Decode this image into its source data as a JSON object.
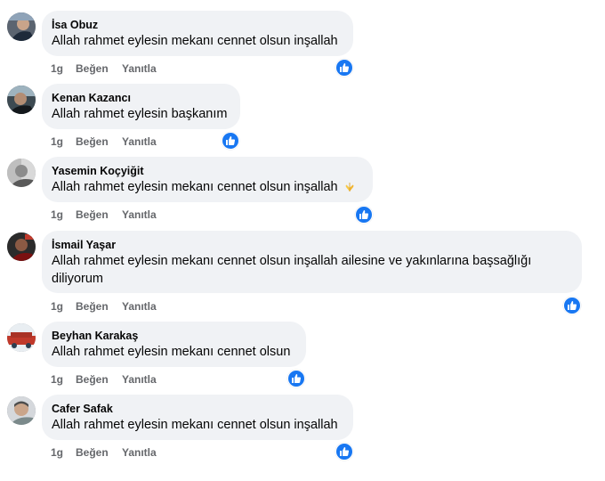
{
  "comments": [
    {
      "author": "İsa Obuz",
      "text": "Allah rahmet eylesin mekanı cennet olsun inşallah",
      "time": "1g",
      "like": "Beğen",
      "reply": "Yanıtla",
      "reaction": "like-icon"
    },
    {
      "author": "Kenan Kazancı",
      "text": "Allah rahmet eylesin başkanım",
      "time": "1g",
      "like": "Beğen",
      "reply": "Yanıtla",
      "reaction": "like-icon"
    },
    {
      "author": "Yasemin Koçyiğit",
      "text": "Allah rahmet eylesin mekanı cennet olsun inşallah",
      "emoji": "praying-hands-emoji",
      "time": "1g",
      "like": "Beğen",
      "reply": "Yanıtla",
      "reaction": "like-icon"
    },
    {
      "author": "İsmail Yaşar",
      "text_line1": "Allah rahmet eylesin mekanı cennet olsun inşallah ailesine ve yakınlarına başsağlığı",
      "text_line2": "diliyorum",
      "time": "1g",
      "like": "Beğen",
      "reply": "Yanıtla",
      "reaction": "like-icon"
    },
    {
      "author": "Beyhan Karakaş",
      "text": "Allah rahmet eylesin mekanı cennet olsun",
      "time": "1g",
      "like": "Beğen",
      "reply": "Yanıtla",
      "reaction": "like-icon"
    },
    {
      "author": "Cafer Safak",
      "text": "Allah rahmet eylesin mekanı cennet olsun inşallah",
      "time": "1g",
      "like": "Beğen",
      "reply": "Yanıtla",
      "reaction": "like-icon"
    }
  ],
  "colors": {
    "bubble": "#f0f2f5",
    "meta": "#65676b",
    "like_blue": "#1877f2",
    "text": "#050505"
  }
}
